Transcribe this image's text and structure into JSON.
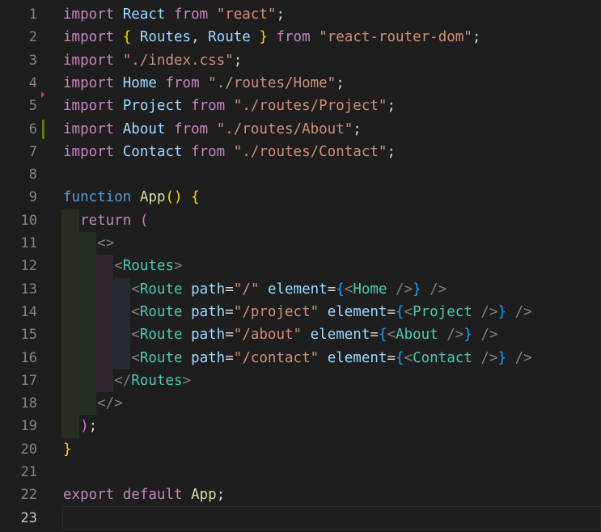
{
  "editor": {
    "active_line": "23",
    "lines": [
      {
        "num": "1",
        "tokens": [
          [
            "kw",
            "import"
          ],
          [
            "pun",
            " "
          ],
          [
            "id",
            "React"
          ],
          [
            "pun",
            " "
          ],
          [
            "kw",
            "from"
          ],
          [
            "pun",
            " "
          ],
          [
            "str",
            "\"react\""
          ],
          [
            "pun",
            ";"
          ]
        ]
      },
      {
        "num": "2",
        "tokens": [
          [
            "kw",
            "import"
          ],
          [
            "pun",
            " "
          ],
          [
            "br1",
            "{"
          ],
          [
            "pun",
            " "
          ],
          [
            "id",
            "Routes"
          ],
          [
            "pun",
            ", "
          ],
          [
            "id",
            "Route"
          ],
          [
            "pun",
            " "
          ],
          [
            "br1",
            "}"
          ],
          [
            "pun",
            " "
          ],
          [
            "kw",
            "from"
          ],
          [
            "pun",
            " "
          ],
          [
            "str",
            "\"react-router-dom\""
          ],
          [
            "pun",
            ";"
          ]
        ]
      },
      {
        "num": "3",
        "tokens": [
          [
            "kw",
            "import"
          ],
          [
            "pun",
            " "
          ],
          [
            "str",
            "\"./index.css\""
          ],
          [
            "pun",
            ";"
          ]
        ]
      },
      {
        "num": "4",
        "tokens": [
          [
            "kw",
            "import"
          ],
          [
            "pun",
            " "
          ],
          [
            "id",
            "Home"
          ],
          [
            "pun",
            " "
          ],
          [
            "kw",
            "from"
          ],
          [
            "pun",
            " "
          ],
          [
            "str",
            "\"./routes/Home\""
          ],
          [
            "pun",
            ";"
          ]
        ]
      },
      {
        "num": "5",
        "tokens": [
          [
            "kw",
            "import"
          ],
          [
            "pun",
            " "
          ],
          [
            "id",
            "Project"
          ],
          [
            "pun",
            " "
          ],
          [
            "kw",
            "from"
          ],
          [
            "pun",
            " "
          ],
          [
            "str",
            "\"./routes/Project\""
          ],
          [
            "pun",
            ";"
          ]
        ]
      },
      {
        "num": "6",
        "tokens": [
          [
            "kw",
            "import"
          ],
          [
            "pun",
            " "
          ],
          [
            "id",
            "About"
          ],
          [
            "pun",
            " "
          ],
          [
            "kw",
            "from"
          ],
          [
            "pun",
            " "
          ],
          [
            "str",
            "\"./routes/About\""
          ],
          [
            "pun",
            ";"
          ]
        ]
      },
      {
        "num": "7",
        "tokens": [
          [
            "kw",
            "import"
          ],
          [
            "pun",
            " "
          ],
          [
            "id",
            "Contact"
          ],
          [
            "pun",
            " "
          ],
          [
            "kw",
            "from"
          ],
          [
            "pun",
            " "
          ],
          [
            "str",
            "\"./routes/Contact\""
          ],
          [
            "pun",
            ";"
          ]
        ]
      },
      {
        "num": "8",
        "tokens": []
      },
      {
        "num": "9",
        "tokens": [
          [
            "kwb",
            "function"
          ],
          [
            "pun",
            " "
          ],
          [
            "fn",
            "App"
          ],
          [
            "br1",
            "()"
          ],
          [
            "pun",
            " "
          ],
          [
            "br1",
            "{"
          ]
        ]
      },
      {
        "num": "10",
        "tokens": [
          [
            "pun",
            "  "
          ],
          [
            "kw",
            "return"
          ],
          [
            "pun",
            " "
          ],
          [
            "br2",
            "("
          ]
        ]
      },
      {
        "num": "11",
        "tokens": [
          [
            "pun",
            "    "
          ],
          [
            "ang",
            "<>"
          ]
        ]
      },
      {
        "num": "12",
        "tokens": [
          [
            "pun",
            "      "
          ],
          [
            "ang",
            "<"
          ],
          [
            "tag",
            "Routes"
          ],
          [
            "ang",
            ">"
          ]
        ]
      },
      {
        "num": "13",
        "tokens": [
          [
            "pun",
            "        "
          ],
          [
            "ang",
            "<"
          ],
          [
            "tag",
            "Route"
          ],
          [
            "pun",
            " "
          ],
          [
            "attr",
            "path"
          ],
          [
            "pun",
            "="
          ],
          [
            "str",
            "\"/\""
          ],
          [
            "pun",
            " "
          ],
          [
            "attr",
            "element"
          ],
          [
            "pun",
            "="
          ],
          [
            "br3",
            "{"
          ],
          [
            "ang",
            "<"
          ],
          [
            "tag",
            "Home"
          ],
          [
            "pun",
            " "
          ],
          [
            "ang",
            "/>"
          ],
          [
            "br3",
            "}"
          ],
          [
            "pun",
            " "
          ],
          [
            "ang",
            "/>"
          ]
        ]
      },
      {
        "num": "14",
        "tokens": [
          [
            "pun",
            "        "
          ],
          [
            "ang",
            "<"
          ],
          [
            "tag",
            "Route"
          ],
          [
            "pun",
            " "
          ],
          [
            "attr",
            "path"
          ],
          [
            "pun",
            "="
          ],
          [
            "str",
            "\"/project\""
          ],
          [
            "pun",
            " "
          ],
          [
            "attr",
            "element"
          ],
          [
            "pun",
            "="
          ],
          [
            "br3",
            "{"
          ],
          [
            "ang",
            "<"
          ],
          [
            "tag",
            "Project"
          ],
          [
            "pun",
            " "
          ],
          [
            "ang",
            "/>"
          ],
          [
            "br3",
            "}"
          ],
          [
            "pun",
            " "
          ],
          [
            "ang",
            "/>"
          ]
        ]
      },
      {
        "num": "15",
        "tokens": [
          [
            "pun",
            "        "
          ],
          [
            "ang",
            "<"
          ],
          [
            "tag",
            "Route"
          ],
          [
            "pun",
            " "
          ],
          [
            "attr",
            "path"
          ],
          [
            "pun",
            "="
          ],
          [
            "str",
            "\"/about\""
          ],
          [
            "pun",
            " "
          ],
          [
            "attr",
            "element"
          ],
          [
            "pun",
            "="
          ],
          [
            "br3",
            "{"
          ],
          [
            "ang",
            "<"
          ],
          [
            "tag",
            "About"
          ],
          [
            "pun",
            " "
          ],
          [
            "ang",
            "/>"
          ],
          [
            "br3",
            "}"
          ],
          [
            "pun",
            " "
          ],
          [
            "ang",
            "/>"
          ]
        ]
      },
      {
        "num": "16",
        "tokens": [
          [
            "pun",
            "        "
          ],
          [
            "ang",
            "<"
          ],
          [
            "tag",
            "Route"
          ],
          [
            "pun",
            " "
          ],
          [
            "attr",
            "path"
          ],
          [
            "pun",
            "="
          ],
          [
            "str",
            "\"/contact\""
          ],
          [
            "pun",
            " "
          ],
          [
            "attr",
            "element"
          ],
          [
            "pun",
            "="
          ],
          [
            "br3",
            "{"
          ],
          [
            "ang",
            "<"
          ],
          [
            "tag",
            "Contact"
          ],
          [
            "pun",
            " "
          ],
          [
            "ang",
            "/>"
          ],
          [
            "br3",
            "}"
          ],
          [
            "pun",
            " "
          ],
          [
            "ang",
            "/>"
          ]
        ]
      },
      {
        "num": "17",
        "tokens": [
          [
            "pun",
            "      "
          ],
          [
            "ang",
            "</"
          ],
          [
            "tag",
            "Routes"
          ],
          [
            "ang",
            ">"
          ]
        ]
      },
      {
        "num": "18",
        "tokens": [
          [
            "pun",
            "    "
          ],
          [
            "ang",
            "</>"
          ]
        ]
      },
      {
        "num": "19",
        "tokens": [
          [
            "pun",
            "  "
          ],
          [
            "br2",
            ")"
          ],
          [
            "pun",
            ";"
          ]
        ]
      },
      {
        "num": "20",
        "tokens": [
          [
            "br1",
            "}"
          ]
        ]
      },
      {
        "num": "21",
        "tokens": []
      },
      {
        "num": "22",
        "tokens": [
          [
            "kw",
            "export"
          ],
          [
            "pun",
            " "
          ],
          [
            "kw",
            "default"
          ],
          [
            "pun",
            " "
          ],
          [
            "fn",
            "App"
          ],
          [
            "pun",
            ";"
          ]
        ]
      },
      {
        "num": "23",
        "tokens": []
      }
    ]
  },
  "colors": {
    "background": "#1e1e1e",
    "keyword": "#c586c0",
    "storage": "#569cd6",
    "identifier": "#9cdcfe",
    "string": "#ce9178",
    "function": "#dcdcaa",
    "jsx_tag": "#4ec9b0",
    "bracket_gold": "#ffd700",
    "bracket_orchid": "#da70d6",
    "bracket_blue": "#179fff",
    "gutter_modified": "#587c0c",
    "gutter_deleted": "#c74e39"
  }
}
